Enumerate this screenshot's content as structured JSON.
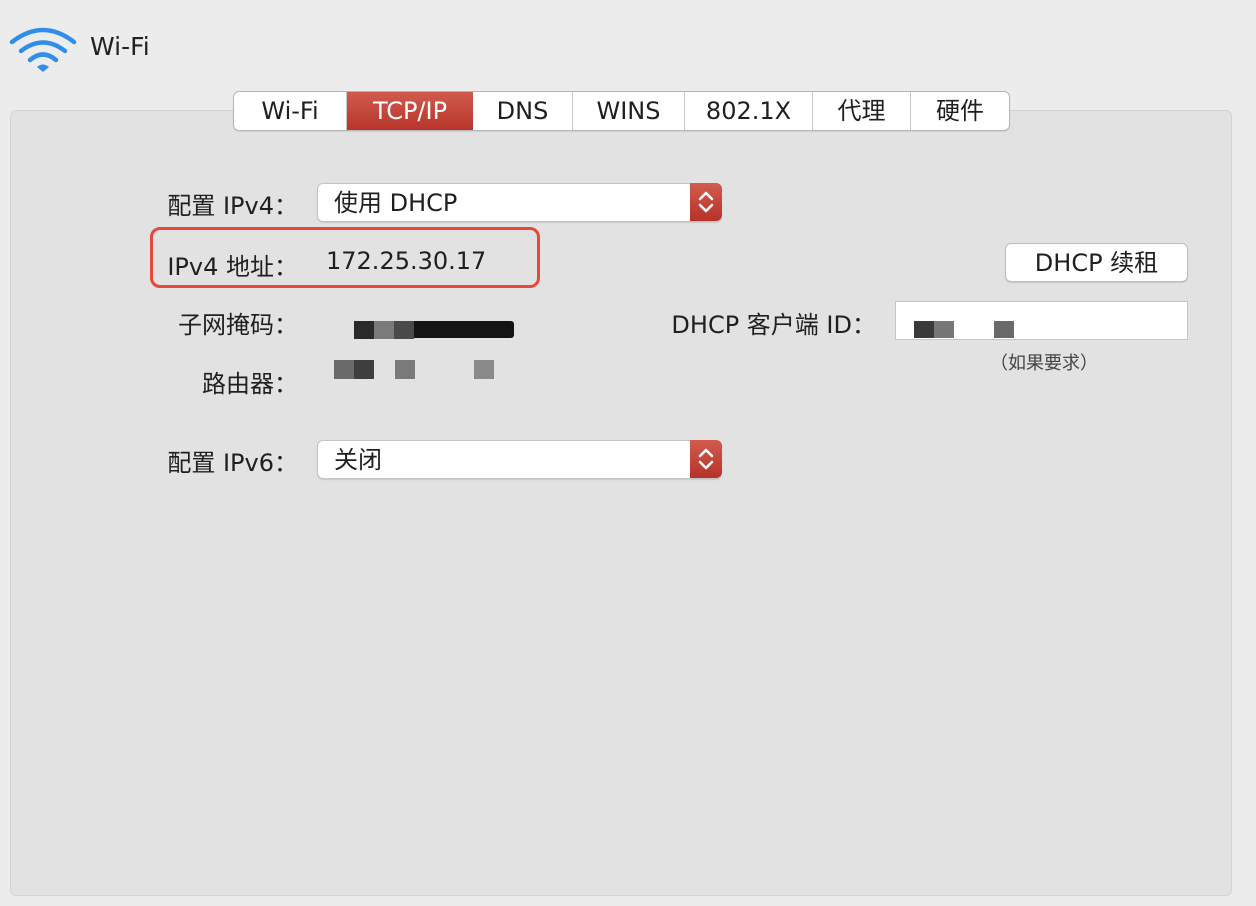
{
  "window": {
    "title": "Wi-Fi",
    "icon": "wifi-icon"
  },
  "tabs": [
    {
      "label": "Wi-Fi",
      "active": false
    },
    {
      "label": "TCP/IP",
      "active": true
    },
    {
      "label": "DNS",
      "active": false
    },
    {
      "label": "WINS",
      "active": false
    },
    {
      "label": "802.1X",
      "active": false
    },
    {
      "label": "代理",
      "active": false
    },
    {
      "label": "硬件",
      "active": false
    }
  ],
  "form": {
    "configure_ipv4_label": "配置 IPv4：",
    "configure_ipv4_value": "使用 DHCP",
    "ipv4_address_label": "IPv4 地址：",
    "ipv4_address_value": "172.25.30.17",
    "subnet_mask_label": "子网掩码：",
    "router_label": "路由器：",
    "configure_ipv6_label": "配置 IPv6：",
    "configure_ipv6_value": "关闭",
    "renew_dhcp_button": "DHCP 续租",
    "dhcp_client_id_label": "DHCP 客户端 ID：",
    "dhcp_client_id_hint": "（如果要求）"
  },
  "colors": {
    "accent": "#c0392b",
    "highlight": "#e8483a",
    "background": "#ececec",
    "panel": "#e2e2e2"
  }
}
